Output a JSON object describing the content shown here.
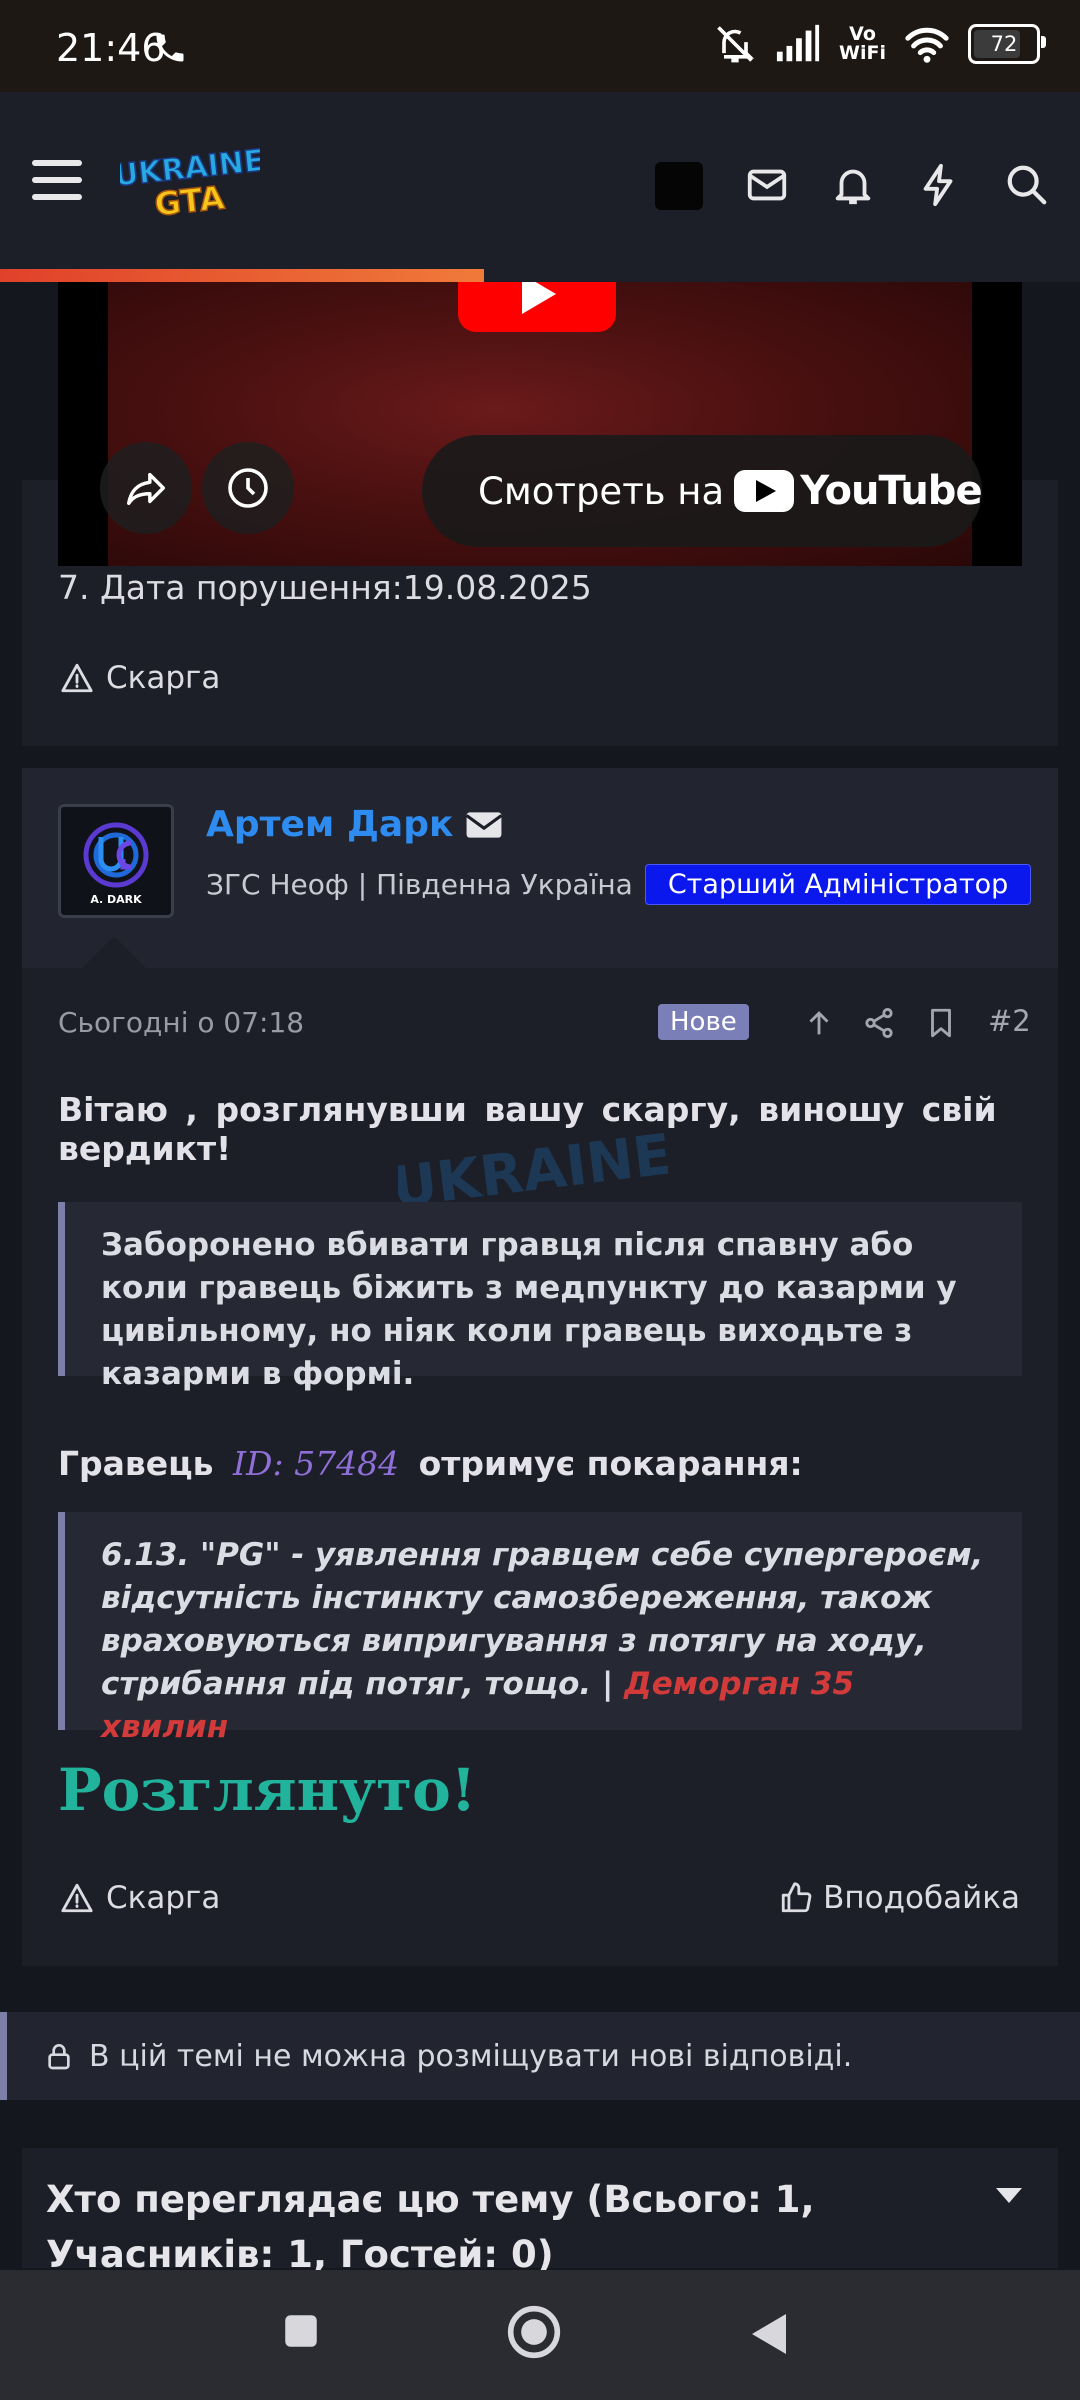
{
  "status_bar": {
    "time": "21:46",
    "battery": "72",
    "vowifi_top": "Vo",
    "vowifi_bottom": "WiFi"
  },
  "header": {
    "logo_text": "UKRAINE GTA"
  },
  "video": {
    "watch_prefix": "Смотреть на",
    "youtube_brand": "YouTube"
  },
  "post1": {
    "violation_date_line": "7. Дата порушення:19.08.2025",
    "complaint_label": "Скарга"
  },
  "post2": {
    "author": "Артем Дарк",
    "subtitle": "ЗГС Неоф | Південна Україна",
    "role": "Старший Адміністратор",
    "avatar_label": "A. DARK",
    "date": "Сьогодні о 07:18",
    "new_badge": "Нове",
    "post_number": "#2",
    "greeting": "Вітаю , розглянувши вашу скаргу, виношу свій вердикт!",
    "quote1": "Заборонено вбивати гравця після спавну або коли гравець біжить з медпункту до казарми у цивільному, но ніяк коли гравець виходьте з казарми в формі.",
    "player_prefix": "Гравець",
    "player_id": "ID: 57484",
    "player_suffix": "отримує покарання:",
    "quote2_text": "6.13. \"PG\" - уявлення гравцем себе супергероєм, відсутність інстинкту самозбереження, також враховуються випригування з потягу на ходу, стрибання під потяг, тощо. | ",
    "quote2_penalty": "Деморган 35 хвилин",
    "verdict": "Розглянуто!",
    "complaint_label": "Скарга",
    "like_label": "Вподобайка"
  },
  "locked_notice": "В цій темі не можна розміщувати нові відповіді.",
  "viewers_title": "Хто переглядає цю тему (Всього: 1, Учасників: 1, Гостей: 0)",
  "colors": {
    "accent_link": "#2e8cf0",
    "role_badge": "#0a18ee",
    "verdict": "#21b39c",
    "penalty": "#d33b3b"
  }
}
